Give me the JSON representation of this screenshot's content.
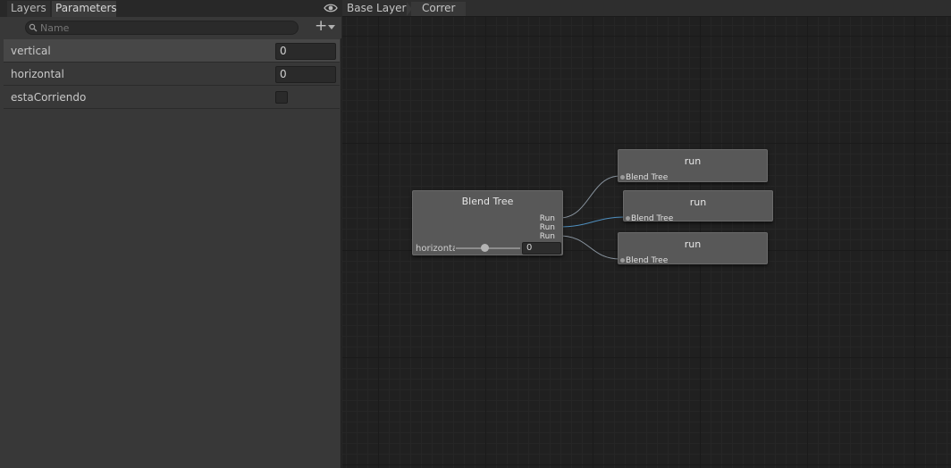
{
  "tabs": {
    "layers": "Layers",
    "parameters": "Parameters"
  },
  "search": {
    "placeholder": "Name"
  },
  "parameters": [
    {
      "name": "vertical",
      "value": "0",
      "type": "float"
    },
    {
      "name": "horizontal",
      "value": "0",
      "type": "float"
    },
    {
      "name": "estaCorriendo",
      "type": "bool",
      "checked": false
    }
  ],
  "breadcrumb": {
    "base_layer": "Base Layer",
    "state": "Correr"
  },
  "blend_tree": {
    "title": "Blend Tree",
    "outputs": [
      "Run",
      "Run",
      "Run"
    ],
    "parameter_label": "horizontal",
    "parameter_value": "0",
    "slider_fraction": 0.45
  },
  "motion_nodes": [
    {
      "title": "run",
      "input_label": "Blend Tree"
    },
    {
      "title": "run",
      "input_label": "Blend Tree"
    },
    {
      "title": "run",
      "input_label": "Blend Tree"
    }
  ],
  "colors": {
    "wire": "#7a8fa3",
    "wire_active": "#5a9fd0",
    "node": "#585858"
  },
  "icons": {
    "visibility": "eye-icon",
    "search": "search-icon",
    "add": "plus-icon"
  }
}
